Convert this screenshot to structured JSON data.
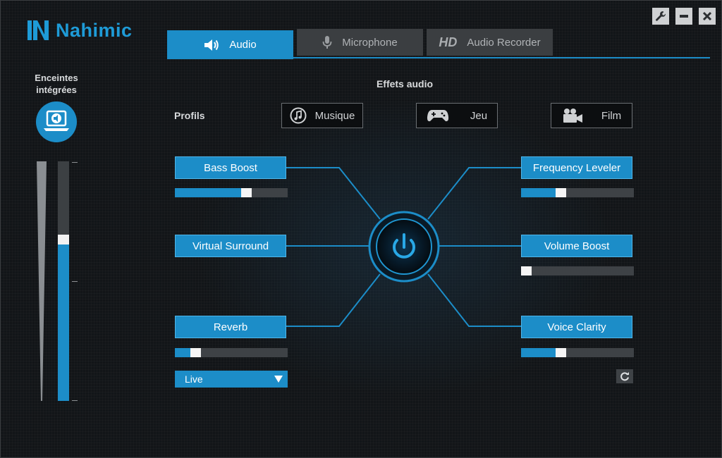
{
  "app": {
    "brand": "Nahimic",
    "colors": {
      "accent": "#1c8dc8",
      "background": "#121518",
      "inactive_tab": "#3b3e41"
    }
  },
  "window_controls": [
    {
      "name": "settings",
      "icon": "wrench-icon"
    },
    {
      "name": "minimize",
      "icon": "minimize-icon"
    },
    {
      "name": "close",
      "icon": "close-icon"
    }
  ],
  "tabs": [
    {
      "label": "Audio",
      "icon": "speaker-icon",
      "active": true
    },
    {
      "label": "Microphone",
      "icon": "microphone-icon",
      "active": false
    },
    {
      "prefix": "HD",
      "label": "Audio Recorder",
      "active": false
    }
  ],
  "device": {
    "label_line1": "Enceintes",
    "label_line2": "intégrées",
    "icon": "laptop-speaker-icon",
    "volume_level": 0.68
  },
  "effects_header": "Effets audio",
  "profiles": {
    "label": "Profils",
    "items": [
      {
        "label": "Musique",
        "icon": "music-note-icon"
      },
      {
        "label": "Jeu",
        "icon": "gamepad-icon"
      },
      {
        "label": "Film",
        "icon": "video-camera-icon"
      }
    ]
  },
  "effects": {
    "bass_boost": {
      "label": "Bass Boost",
      "level": 0.65
    },
    "virtual_surround": {
      "label": "Virtual Surround"
    },
    "reverb": {
      "label": "Reverb",
      "level": 0.15,
      "preset": "Live"
    },
    "frequency_leveler": {
      "label": "Frequency Leveler",
      "level": 0.34
    },
    "volume_boost": {
      "label": "Volume Boost",
      "level": 0.0
    },
    "voice_clarity": {
      "label": "Voice Clarity",
      "level": 0.34
    }
  },
  "power": {
    "icon": "power-icon",
    "state": "on"
  },
  "reset": {
    "icon": "refresh-icon"
  }
}
